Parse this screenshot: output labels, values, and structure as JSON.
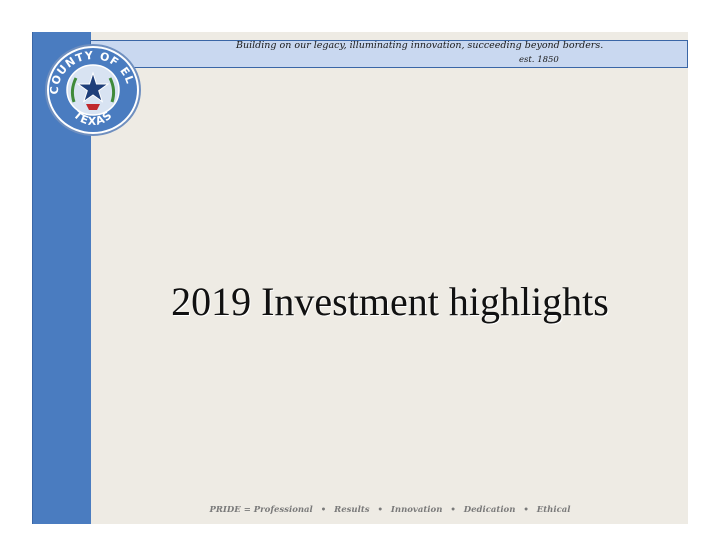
{
  "header": {
    "tagline": "Building on our legacy, illuminating innovation, succeeding beyond borders.",
    "established": "est. 1850"
  },
  "seal": {
    "text_top": "THE COUNTY OF EL PASO",
    "text_bottom": "TEXAS"
  },
  "slide": {
    "title": "2019 Investment highlights"
  },
  "footer": {
    "label": "PRIDE = Professional",
    "items": [
      "Results",
      "Innovation",
      "Dedication",
      "Ethical"
    ],
    "separator": "•"
  },
  "colors": {
    "accent_blue": "#4a7cc0",
    "header_band": "#c9d8f0",
    "slide_background": "#eeebe4"
  }
}
